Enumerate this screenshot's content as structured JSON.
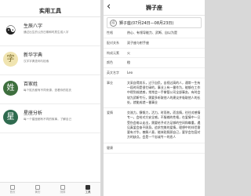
{
  "left": {
    "header_title": "实用工具",
    "tools": [
      {
        "icon": "☯",
        "icon_color": "#222222",
        "icon_bg": "#ffffff",
        "title": "生辰八字",
        "desc": "通过出生的公历日期和时辰生成八字"
      },
      {
        "icon": "字",
        "icon_color": "#7a6a2a",
        "icon_bg": "#f0e4b0",
        "title": "新华字典",
        "desc": "汉字字典查询与检索"
      },
      {
        "icon": "姓",
        "icon_color": "#ffffff",
        "icon_bg": "#3e6f3e",
        "title": "百家姓",
        "desc": "每个姓氏都有不同来源，查看你的姓氏"
      },
      {
        "icon": "星",
        "icon_color": "#ffffff",
        "icon_bg": "#2f6b4f",
        "title": "星座分析",
        "desc": "每一个星座都有不同的故事，了解自己"
      }
    ],
    "tabs": [
      {
        "label": "首页",
        "active": false
      },
      {
        "label": "黄历",
        "active": false
      },
      {
        "label": "测算",
        "active": false
      },
      {
        "label": "工具",
        "active": true
      }
    ]
  },
  "right": {
    "title": "狮子座",
    "back_icon": "‹",
    "zodiac_icon": "♌",
    "zodiac_text": "狮子座(07月24日—08月23日)",
    "rows": [
      {
        "label": "性格",
        "value": "热心、有领导能力、武断、自以为是"
      },
      {
        "label": "配对关系",
        "value": "双子座与射手座"
      },
      {
        "label": "构成元素",
        "value": "火"
      },
      {
        "label": "颜色",
        "value": "橙"
      },
      {
        "label": "英文名字",
        "value": "Leo"
      },
      {
        "label": "事业",
        "value": "文采自得其乐，过于自负，自视过高的人，通常一生有一段时间是很忙碌的，事业上有一番作为，能够在工作中得到成就感，常常会一手掌管公司全部事务，有时会较为武断专行，需要多听取他人的建议并吸取他人的长处，就能成就一番事业"
      },
      {
        "label": "爱情",
        "value": "交流力，慷慨力，活力，时而热，而含情，往往对感情专一，会给对方安全感。不服输的性格，在爱情中一旦受伤会难以走出，需要给予对方足够的空间和尊重，遇见真爱会奋不顾身。追求完美的爱情，理想中的伴侣需要有才华，善解人意，能体贴照顾自己，要学会包容对方的缺点。会是一个忠诚专一的恋人"
      },
      {
        "label": "健康",
        "value": ""
      }
    ]
  }
}
